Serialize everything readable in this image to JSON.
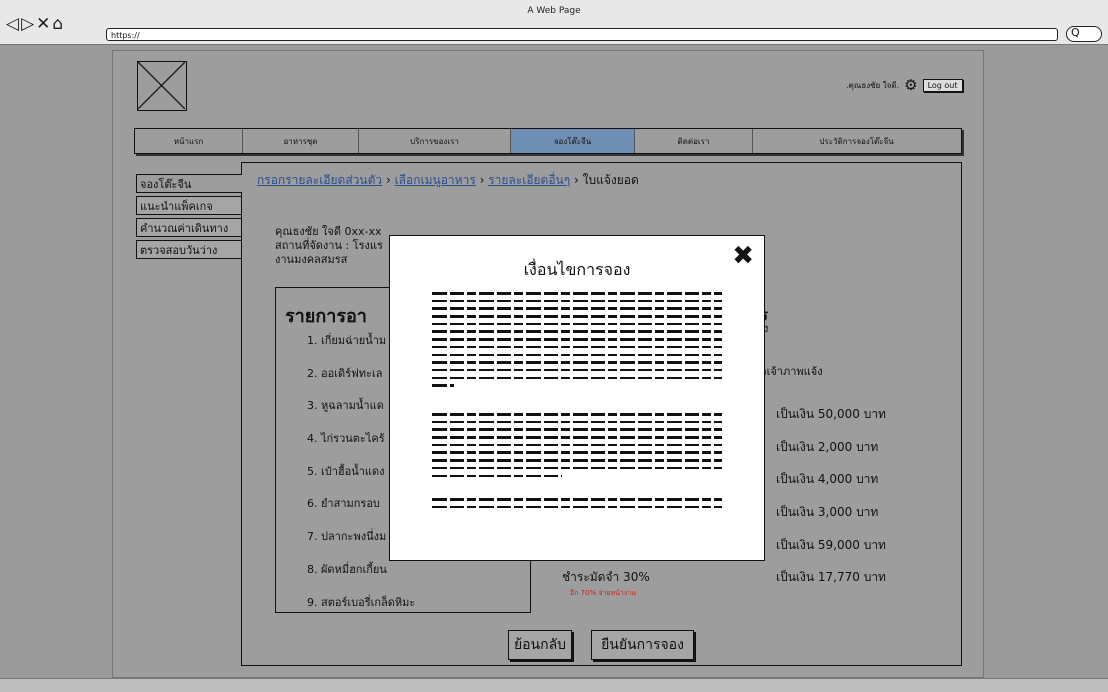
{
  "browser": {
    "window_title": "A Web Page",
    "url": "https://",
    "nav_icons": "◁▷✕⌂",
    "search_glyph": "Q"
  },
  "header": {
    "user_name": ".คุณธงชัย ใจดี.",
    "logout": "Log out"
  },
  "nav": {
    "tabs": [
      {
        "label": "หน้าแรก",
        "active": false
      },
      {
        "label": "อาหารชุด",
        "active": false
      },
      {
        "label": "บริการของเรา",
        "active": false
      },
      {
        "label": "จองโต๊ะจีน",
        "active": true
      },
      {
        "label": "ติดต่อเรา",
        "active": false
      },
      {
        "label": "ประวัติการจองโต๊ะจีน",
        "active": false
      }
    ]
  },
  "side_menu": {
    "items": [
      {
        "label": "จองโต๊ะจีน"
      },
      {
        "label": "แนะนำแพ็คเกจ"
      },
      {
        "label": "คำนวณค่าเดินทาง"
      },
      {
        "label": "ตรวจสอบวันว่าง"
      }
    ]
  },
  "breadcrumb": {
    "step1": "กรอกรายละเอียดส่วนตัว",
    "step2": "เลือกเมนูอาหาร",
    "step3": "รายละเอียดอื่นๆ",
    "current": "ใบแจ้งยอด",
    "sep": " › "
  },
  "info": {
    "line1": "คุณธงชัย ใจดี 0xx-xx",
    "line2": "สถานที่จัดงาน : โรงแร",
    "line3": "งานมงคลสมรส"
  },
  "order": {
    "title": "รายการอา",
    "items": [
      "1. เกี่ยมฉ่ายน้ำม",
      "2. ออเดิร์ฟทะเล",
      "3. หูฉลามน้ำแด",
      "4. ไก่รวนตะไคร้",
      "5. เป๋าฮื้อน้ำแดง",
      "6. ยำสามกรอบ",
      "7. ปลากะพงนึ่งม",
      "8. ผัดหมี่ฮกเกี้ยน",
      "9. สตอร์เบอรี่เกล็ดหิมะ"
    ],
    "prices": [
      "เป็นเงิน 50,000 บาท",
      "เป็นเงิน 2,000 บาท",
      "เป็นเงิน 4,000 บาท",
      "เป็นเงิน 3,000 บาท",
      "เป็นเงิน 59,000 บาท",
      "เป็นเงิน 17,770 บาท"
    ],
    "right_frag1": "ร",
    "right_frag2": "ง",
    "right_frag3": "อเจ้าภาพแจ้ง",
    "deposit": "ชำระมัดจำ 30%",
    "deposit_note": "อีก 70% จ่ายหน้างาน"
  },
  "buttons": {
    "back": "ย้อนกลับ",
    "confirm": "ยืนยันการจอง"
  },
  "modal": {
    "title": "เงื่อนไขการจอง",
    "close": "✖"
  }
}
